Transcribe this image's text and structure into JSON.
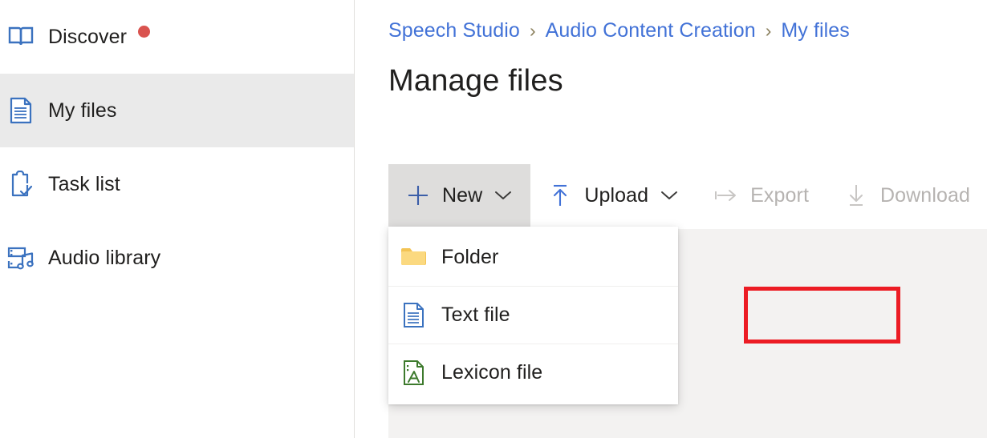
{
  "sidebar": {
    "items": [
      {
        "label": "Discover",
        "icon": "book-icon",
        "selected": false,
        "badge_dot": true
      },
      {
        "label": "My files",
        "icon": "document-icon",
        "selected": true,
        "badge_dot": false
      },
      {
        "label": "Task list",
        "icon": "clipboard-check-icon",
        "selected": false,
        "badge_dot": false
      },
      {
        "label": "Audio library",
        "icon": "audio-library-icon",
        "selected": false,
        "badge_dot": false
      }
    ]
  },
  "breadcrumb": {
    "items": [
      "Speech Studio",
      "Audio Content Creation",
      "My files"
    ],
    "separator": "›"
  },
  "main": {
    "title": "Manage files"
  },
  "toolbar": {
    "items": [
      {
        "label": "New",
        "icon": "plus-icon",
        "chevron": true,
        "state": "active"
      },
      {
        "label": "Upload",
        "icon": "upload-arrow-icon",
        "chevron": true,
        "state": "enabled"
      },
      {
        "label": "Export",
        "icon": "export-arrow-icon",
        "chevron": false,
        "state": "disabled"
      },
      {
        "label": "Download",
        "icon": "download-arrow-icon",
        "chevron": false,
        "state": "disabled"
      }
    ]
  },
  "new_menu": {
    "items": [
      {
        "label": "Folder",
        "icon": "folder-icon",
        "highlighted": false
      },
      {
        "label": "Text file",
        "icon": "text-file-icon",
        "highlighted": true
      },
      {
        "label": "Lexicon file",
        "icon": "lexicon-file-icon",
        "highlighted": false
      }
    ]
  },
  "colors": {
    "accent_blue": "#4272d7",
    "icon_blue": "#3b72bf",
    "badge_red": "#d9534f",
    "annotation_red": "#ec1c24",
    "folder_yellow": "#f7cf6b",
    "lexicon_green": "#3d7a2d",
    "selected_gray": "#eaeaea",
    "content_gray": "#f3f2f1",
    "disabled_gray": "#b6b3b1"
  }
}
